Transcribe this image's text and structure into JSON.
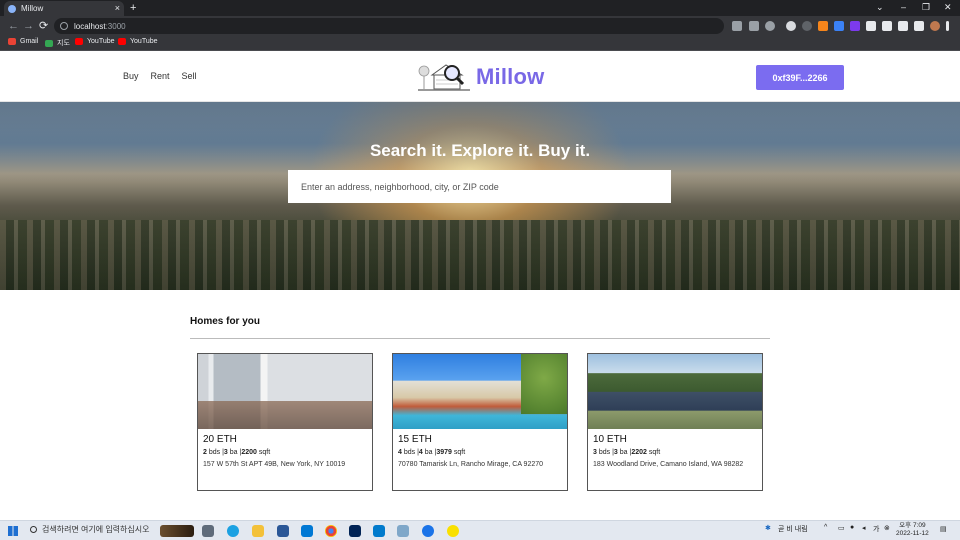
{
  "browser": {
    "tab_title": "Millow",
    "tab_close": "×",
    "new_tab": "+",
    "url_host": "localhost",
    "url_port": ":3000",
    "window_controls": [
      "⌄",
      "–",
      "❐",
      "✕"
    ],
    "nav_icons": [
      "back-arrow-icon",
      "forward-arrow-icon",
      "reload-icon"
    ],
    "nav_glyphs": [
      "←",
      "→",
      "⟳"
    ],
    "bookmarks": [
      {
        "label": "Gmail",
        "color": "#ea4335"
      },
      {
        "label": "지도",
        "color": "#34a853"
      },
      {
        "label": "YouTube",
        "color": "#ff0000"
      },
      {
        "label": "YouTube",
        "color": "#ff0000"
      }
    ]
  },
  "nav": {
    "links": [
      "Buy",
      "Rent",
      "Sell"
    ],
    "brand": "Millow",
    "account_button": "0xf39F...2266"
  },
  "hero": {
    "headline": "Search it. Explore it. Buy it.",
    "search_placeholder": "Enter an address, neighborhood, city, or ZIP code"
  },
  "section_title": "Homes for you",
  "homes": [
    {
      "price": "20 ETH",
      "beds": "2",
      "beds_label": "bds",
      "baths": "3",
      "baths_label": "ba",
      "sqft": "2200",
      "sqft_label": "sqft",
      "address": "157 W 57th St APT 49B, New York, NY 10019"
    },
    {
      "price": "15 ETH",
      "beds": "4",
      "beds_label": "bds",
      "baths": "4",
      "baths_label": "ba",
      "sqft": "3979",
      "sqft_label": "sqft",
      "address": "70780 Tamarisk Ln, Rancho Mirage, CA 92270"
    },
    {
      "price": "10 ETH",
      "beds": "3",
      "beds_label": "bds",
      "baths": "3",
      "baths_label": "ba",
      "sqft": "2202",
      "sqft_label": "sqft",
      "address": "183 Woodland Drive, Camano Island, WA 98282"
    }
  ],
  "taskbar": {
    "search_text": "검색하려면 여기에 입력하십시오",
    "weather": "곧 비 내림",
    "clock_time": "오후 7:09",
    "clock_date": "2022-11-12"
  },
  "colors": {
    "accent": "#7b6cf0",
    "brand": "#7968e6"
  }
}
